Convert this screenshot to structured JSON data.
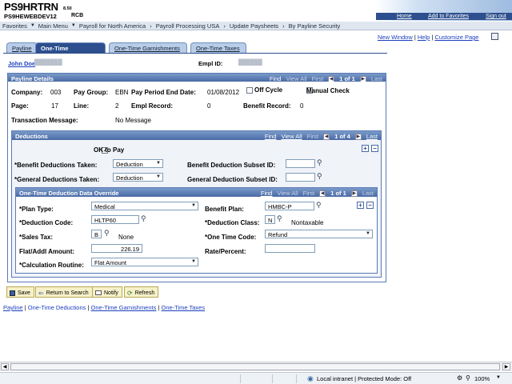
{
  "header": {
    "title": "PS9HRTRN",
    "title_sub": "8.50",
    "db": "PS9HEWEBDEV12",
    "user": "RCB",
    "links": [
      "Home",
      "Add to Favorites",
      "Sign out"
    ]
  },
  "menubar": {
    "items": [
      "Favorites",
      "Main Menu",
      "Payroll for North America",
      "Payroll Processing USA",
      "Update Paysheets",
      "By Payline Security"
    ]
  },
  "util": {
    "new_window": "New Window",
    "help": "Help",
    "customize": "Customize Page"
  },
  "tabs": [
    "Payline",
    "One-Time Deductions",
    "One-Time Garnishments",
    "One-Time Taxes"
  ],
  "employee": {
    "name": "John Doe",
    "name_masked": "███████",
    "emplid_label": "Empl ID:",
    "emplid_masked": "██████"
  },
  "payline": {
    "section": "Payline Details",
    "find": "Find",
    "view_all": "View All",
    "first": "First",
    "count": "1 of 1",
    "last": "Last",
    "company_label": "Company:",
    "company": "003",
    "paygroup_label": "Pay Group:",
    "paygroup": "EBN",
    "ped_label": "Pay Period End Date:",
    "ped": "01/08/2012",
    "offcycle_label": "Off Cycle",
    "manual_label": "Manual Check",
    "page_label": "Page:",
    "page": "17",
    "line_label": "Line:",
    "line": "2",
    "emplrec_label": "Empl Record:",
    "emplrec": "0",
    "benrec_label": "Benefit Record:",
    "benrec": "0",
    "msg_label": "Transaction Message:",
    "msg": "No Message"
  },
  "deductions": {
    "section": "Deductions",
    "find": "Find",
    "view_all": "View All",
    "first": "First",
    "count": "1 of 4",
    "last": "Last",
    "ok_to_pay": "OK to Pay",
    "ben_taken_label": "*Benefit Deductions Taken:",
    "ben_taken": "Deduction",
    "ben_subset_label": "Benefit Deduction Subset ID:",
    "gen_taken_label": "*General Deductions Taken:",
    "gen_taken": "Deduction",
    "gen_subset_label": "General Deduction Subset ID:"
  },
  "override": {
    "section": "One-Time Deduction Data Override",
    "find": "Find",
    "view_all": "View All",
    "first": "First",
    "count": "1 of 1",
    "last": "Last",
    "plan_label": "*Plan Type:",
    "plan": "Medical",
    "benplan_label": "Benefit Plan:",
    "benplan": "HMBC-P",
    "dcode_label": "*Deduction Code:",
    "dcode": "HLTP60",
    "dclass_label": "*Deduction Class:",
    "dclass": "N",
    "dclass_desc": "Nontaxable",
    "stax_label": "*Sales Tax:",
    "stax": "B",
    "stax_desc": "None",
    "otc_label": "*One Time Code:",
    "otc": "Refund",
    "flat_label": "Flat/Addl Amount:",
    "flat": "226.19",
    "rate_label": "Rate/Percent:",
    "rate": "",
    "calc_label": "*Calculation Routine:",
    "calc": "Flat Amount"
  },
  "buttons": {
    "save": "Save",
    "return": "Return to Search",
    "notify": "Notify",
    "refresh": "Refresh"
  },
  "footer_links": [
    "Payline",
    "One-Time Deductions",
    "One-Time Garnishments",
    "One-Time Taxes"
  ],
  "statusbar": {
    "zone": "Local intranet | Protected Mode: Off",
    "zoom": "100%"
  },
  "colors": {
    "accent": "#2d4f8e",
    "grid_header": "#5a7ab5",
    "panel_border": "#5a7ab5",
    "button_bg": "#f6f1c8"
  }
}
